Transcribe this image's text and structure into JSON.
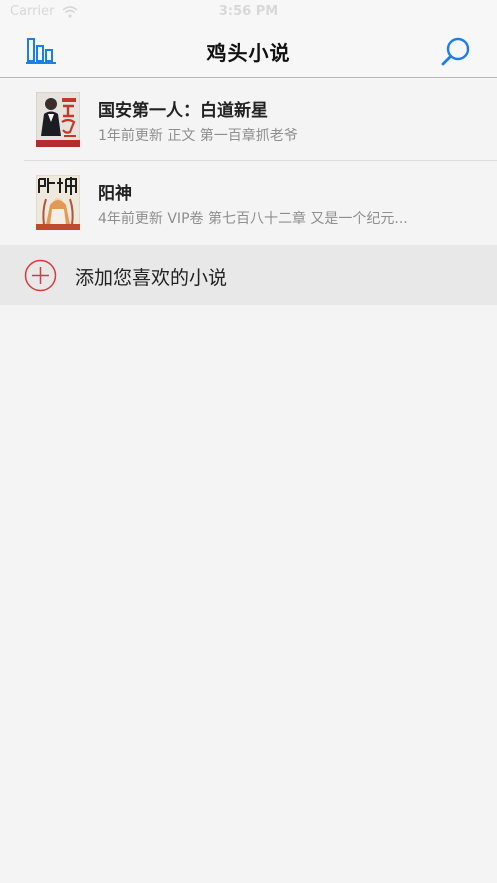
{
  "status": {
    "carrier": "Carrier",
    "time": "3:56 PM"
  },
  "nav": {
    "title": "鸡头小说",
    "left_icon": "bookshelf-chart-icon",
    "right_icon": "search-icon"
  },
  "books": [
    {
      "title": "国安第一人：白道新星",
      "subtitle": "1年前更新 正文 第一百章抓老爷",
      "cover_icon": "book-cover"
    },
    {
      "title": "阳神",
      "subtitle": "4年前更新 VIP卷 第七百八十二章 又是一个纪元...",
      "cover_icon": "book-cover"
    }
  ],
  "add": {
    "label": "添加您喜欢的小说",
    "icon": "plus-circle-icon"
  },
  "colors": {
    "accent": "#1a7fe6",
    "add_red": "#d63a3a",
    "background": "#f4f4f4"
  }
}
